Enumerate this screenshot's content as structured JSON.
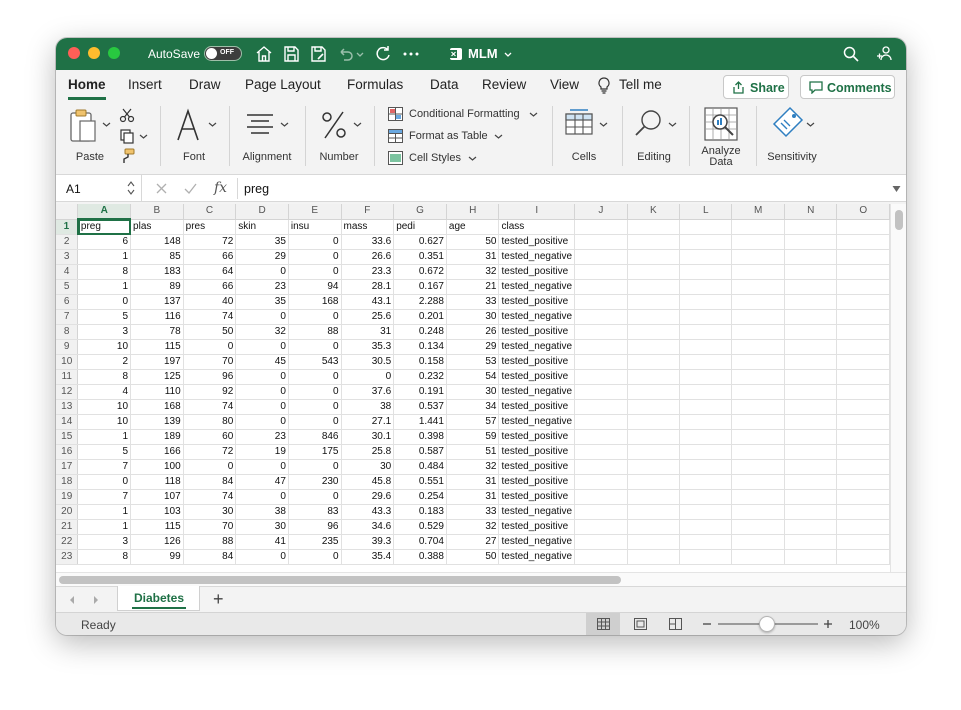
{
  "titlebar": {
    "autosave_label": "AutoSave",
    "autosave_state": "OFF",
    "doc_title": "MLM"
  },
  "ribbon_tabs": [
    "Home",
    "Insert",
    "Draw",
    "Page Layout",
    "Formulas",
    "Data",
    "Review",
    "View"
  ],
  "tell_me": "Tell me",
  "share_label": "Share",
  "comments_label": "Comments",
  "ribbon": {
    "paste": "Paste",
    "font": "Font",
    "alignment": "Alignment",
    "number": "Number",
    "conditional_formatting": "Conditional Formatting",
    "format_as_table": "Format as Table",
    "cell_styles": "Cell Styles",
    "cells": "Cells",
    "editing": "Editing",
    "analyze_data_1": "Analyze",
    "analyze_data_2": "Data",
    "sensitivity": "Sensitivity"
  },
  "formula_bar": {
    "name_box": "A1",
    "fx": "fx",
    "formula": "preg"
  },
  "columns": [
    "A",
    "B",
    "C",
    "D",
    "E",
    "F",
    "G",
    "H",
    "I",
    "J",
    "K",
    "L",
    "M",
    "N",
    "O"
  ],
  "header_row": [
    "preg",
    "plas",
    "pres",
    "skin",
    "insu",
    "mass",
    "pedi",
    "age",
    "class"
  ],
  "rows": [
    [
      "6",
      "148",
      "72",
      "35",
      "0",
      "33.6",
      "0.627",
      "50",
      "tested_positive"
    ],
    [
      "1",
      "85",
      "66",
      "29",
      "0",
      "26.6",
      "0.351",
      "31",
      "tested_negative"
    ],
    [
      "8",
      "183",
      "64",
      "0",
      "0",
      "23.3",
      "0.672",
      "32",
      "tested_positive"
    ],
    [
      "1",
      "89",
      "66",
      "23",
      "94",
      "28.1",
      "0.167",
      "21",
      "tested_negative"
    ],
    [
      "0",
      "137",
      "40",
      "35",
      "168",
      "43.1",
      "2.288",
      "33",
      "tested_positive"
    ],
    [
      "5",
      "116",
      "74",
      "0",
      "0",
      "25.6",
      "0.201",
      "30",
      "tested_negative"
    ],
    [
      "3",
      "78",
      "50",
      "32",
      "88",
      "31",
      "0.248",
      "26",
      "tested_positive"
    ],
    [
      "10",
      "115",
      "0",
      "0",
      "0",
      "35.3",
      "0.134",
      "29",
      "tested_negative"
    ],
    [
      "2",
      "197",
      "70",
      "45",
      "543",
      "30.5",
      "0.158",
      "53",
      "tested_positive"
    ],
    [
      "8",
      "125",
      "96",
      "0",
      "0",
      "0",
      "0.232",
      "54",
      "tested_positive"
    ],
    [
      "4",
      "110",
      "92",
      "0",
      "0",
      "37.6",
      "0.191",
      "30",
      "tested_negative"
    ],
    [
      "10",
      "168",
      "74",
      "0",
      "0",
      "38",
      "0.537",
      "34",
      "tested_positive"
    ],
    [
      "10",
      "139",
      "80",
      "0",
      "0",
      "27.1",
      "1.441",
      "57",
      "tested_negative"
    ],
    [
      "1",
      "189",
      "60",
      "23",
      "846",
      "30.1",
      "0.398",
      "59",
      "tested_positive"
    ],
    [
      "5",
      "166",
      "72",
      "19",
      "175",
      "25.8",
      "0.587",
      "51",
      "tested_positive"
    ],
    [
      "7",
      "100",
      "0",
      "0",
      "0",
      "30",
      "0.484",
      "32",
      "tested_positive"
    ],
    [
      "0",
      "118",
      "84",
      "47",
      "230",
      "45.8",
      "0.551",
      "31",
      "tested_positive"
    ],
    [
      "7",
      "107",
      "74",
      "0",
      "0",
      "29.6",
      "0.254",
      "31",
      "tested_positive"
    ],
    [
      "1",
      "103",
      "30",
      "38",
      "83",
      "43.3",
      "0.183",
      "33",
      "tested_negative"
    ],
    [
      "1",
      "115",
      "70",
      "30",
      "96",
      "34.6",
      "0.529",
      "32",
      "tested_positive"
    ],
    [
      "3",
      "126",
      "88",
      "41",
      "235",
      "39.3",
      "0.704",
      "27",
      "tested_negative"
    ],
    [
      "8",
      "99",
      "84",
      "0",
      "0",
      "35.4",
      "0.388",
      "50",
      "tested_negative"
    ]
  ],
  "sheet_tabs": [
    "Diabetes"
  ],
  "add_sheet": "+",
  "status": {
    "ready": "Ready",
    "zoom": "100%"
  },
  "colors": {
    "brand": "#1f7146",
    "close": "#fe5f57",
    "minimize": "#febc2e",
    "maximize": "#28c840"
  }
}
